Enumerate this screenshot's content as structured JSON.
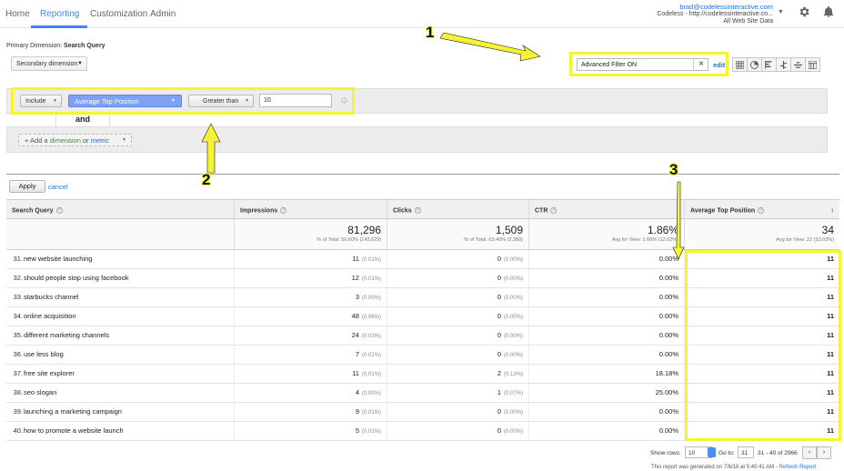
{
  "nav": {
    "tabs": [
      "Home",
      "Reporting",
      "Customization",
      "Admin"
    ],
    "active_index": 1
  },
  "account": {
    "email": "brad@codelessinteractive.com",
    "property": "Codeless - http://codelessinteractive.co...",
    "view": "All Web Site Data"
  },
  "dims": {
    "primary_label": "Primary Dimension:",
    "primary_value": "Search Query",
    "secondary_label": "Secondary dimension"
  },
  "search": {
    "value": "Advanced Filter ON",
    "edit_label": "edit"
  },
  "filter": {
    "include_label": "Include",
    "metric_label": "Average Top Position",
    "operator_label": "Greater than",
    "value": "10",
    "and_label": "and",
    "add_prefix": "+ Add a ",
    "add_dimension": "dimension",
    "add_or": " or ",
    "add_metric": "metric"
  },
  "actions": {
    "apply_label": "Apply",
    "cancel_label": "cancel"
  },
  "table": {
    "headers": {
      "query": "Search Query",
      "impressions": "Impressions",
      "clicks": "Clicks",
      "ctr": "CTR",
      "position": "Average Top Position"
    },
    "totals": {
      "impressions": "81,296",
      "impressions_sub": "% of Total: 56.60% (143,629)",
      "clicks": "1,509",
      "clicks_sub": "% of Total: 63.40% (2,380)",
      "ctr": "1.86%",
      "ctr_sub": "Avg for View: 1.66% (12.02%)",
      "position": "34",
      "position_sub": "Avg for View: 22 (53.03%)"
    },
    "rows": [
      {
        "idx": "31.",
        "query": "new website launching",
        "impr": "11",
        "impr_pct": "(0.01%)",
        "clicks": "0",
        "clicks_pct": "(0.00%)",
        "ctr": "0.00%",
        "pos": "11"
      },
      {
        "idx": "32.",
        "query": "should people stop using facebook",
        "impr": "12",
        "impr_pct": "(0.01%)",
        "clicks": "0",
        "clicks_pct": "(0.00%)",
        "ctr": "0.00%",
        "pos": "11"
      },
      {
        "idx": "33.",
        "query": "starbucks channel",
        "impr": "3",
        "impr_pct": "(0.00%)",
        "clicks": "0",
        "clicks_pct": "(0.00%)",
        "ctr": "0.00%",
        "pos": "11"
      },
      {
        "idx": "34.",
        "query": "online acquisition",
        "impr": "48",
        "impr_pct": "(0.06%)",
        "clicks": "0",
        "clicks_pct": "(0.00%)",
        "ctr": "0.00%",
        "pos": "11"
      },
      {
        "idx": "35.",
        "query": "different marketing channels",
        "impr": "24",
        "impr_pct": "(0.03%)",
        "clicks": "0",
        "clicks_pct": "(0.00%)",
        "ctr": "0.00%",
        "pos": "11"
      },
      {
        "idx": "36.",
        "query": "use less blog",
        "impr": "7",
        "impr_pct": "(0.01%)",
        "clicks": "0",
        "clicks_pct": "(0.00%)",
        "ctr": "0.00%",
        "pos": "11"
      },
      {
        "idx": "37.",
        "query": "free site explorer",
        "impr": "11",
        "impr_pct": "(0.01%)",
        "clicks": "2",
        "clicks_pct": "(0.13%)",
        "ctr": "18.18%",
        "pos": "11"
      },
      {
        "idx": "38.",
        "query": "seo slogan",
        "impr": "4",
        "impr_pct": "(0.00%)",
        "clicks": "1",
        "clicks_pct": "(0.07%)",
        "ctr": "25.00%",
        "pos": "11"
      },
      {
        "idx": "39.",
        "query": "launching a marketing campaign",
        "impr": "9",
        "impr_pct": "(0.01%)",
        "clicks": "0",
        "clicks_pct": "(0.00%)",
        "ctr": "0.00%",
        "pos": "11"
      },
      {
        "idx": "40.",
        "query": "how to promote a website launch",
        "impr": "5",
        "impr_pct": "(0.01%)",
        "clicks": "0",
        "clicks_pct": "(0.00%)",
        "ctr": "0.00%",
        "pos": "11"
      }
    ]
  },
  "pager": {
    "show_rows_label": "Show rows:",
    "rows_value": "10",
    "goto_label": "Go to:",
    "goto_value": "31",
    "range": "31 - 40 of 2966"
  },
  "footer": {
    "note": "This report was generated on 7/6/16 at 5:40:41 AM - ",
    "refresh": "Refresh Report"
  },
  "annotations": {
    "one": "1",
    "two": "2",
    "three": "3"
  },
  "colors": {
    "accent": "#4285f4",
    "highlight": "#f6f431"
  }
}
